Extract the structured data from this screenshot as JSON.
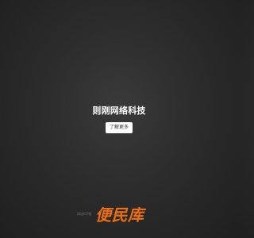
{
  "hero": {
    "title": "则刚网络科技",
    "button_label": "了解更多"
  },
  "footer": {
    "copyright": "网站ICP备",
    "link": "ICP备"
  },
  "watermark": {
    "text": "便民库"
  },
  "colors": {
    "background": "#2c2c2c",
    "title": "#ffffff",
    "button_bg": "#ffffff",
    "watermark": "#ed6f12"
  }
}
